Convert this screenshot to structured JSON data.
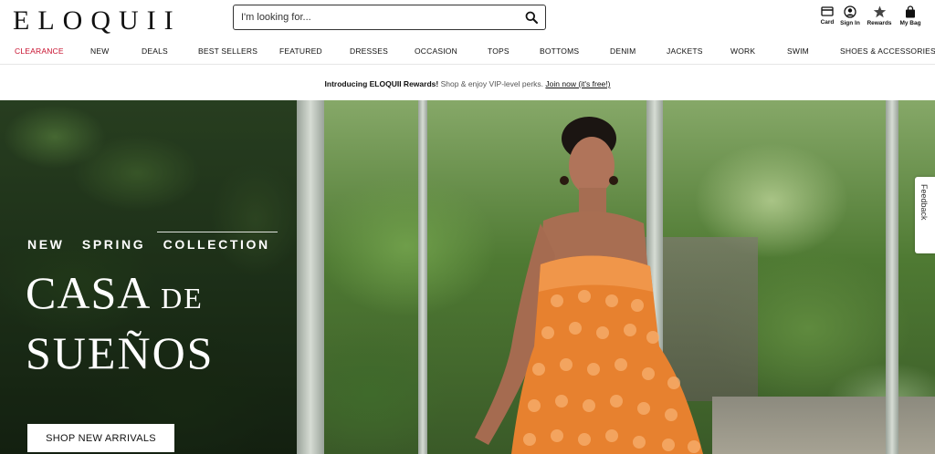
{
  "brand": {
    "logo": "ELOQUII"
  },
  "search": {
    "placeholder": "I'm looking for..."
  },
  "utilities": [
    {
      "label": "Card",
      "icon": "card-icon"
    },
    {
      "label": "Sign In",
      "icon": "user-icon"
    },
    {
      "label": "Rewards",
      "icon": "star-icon"
    },
    {
      "label": "My Bag",
      "icon": "bag-icon"
    }
  ],
  "nav": {
    "items": [
      "CLEARANCE",
      "NEW",
      "DEALS",
      "BEST SELLERS",
      "FEATURED",
      "DRESSES",
      "OCCASION",
      "TOPS",
      "BOTTOMS",
      "DENIM",
      "JACKETS",
      "WORK",
      "SWIM",
      "SHOES & ACCESSORIES"
    ],
    "clearance_color": "#c8102e"
  },
  "promo": {
    "strong": "Introducing ELOQUII Rewards!",
    "light": "Shop & enjoy VIP-level perks.",
    "link": "Join now (it's free!)"
  },
  "hero": {
    "eyebrow": "NEW   SPRING   COLLECTION",
    "title_main": "CASA",
    "title_small": "DE",
    "title_line2": "SUEÑOS",
    "cta": "SHOP NEW ARRIVALS"
  },
  "feedback": {
    "label": "Feedback"
  }
}
